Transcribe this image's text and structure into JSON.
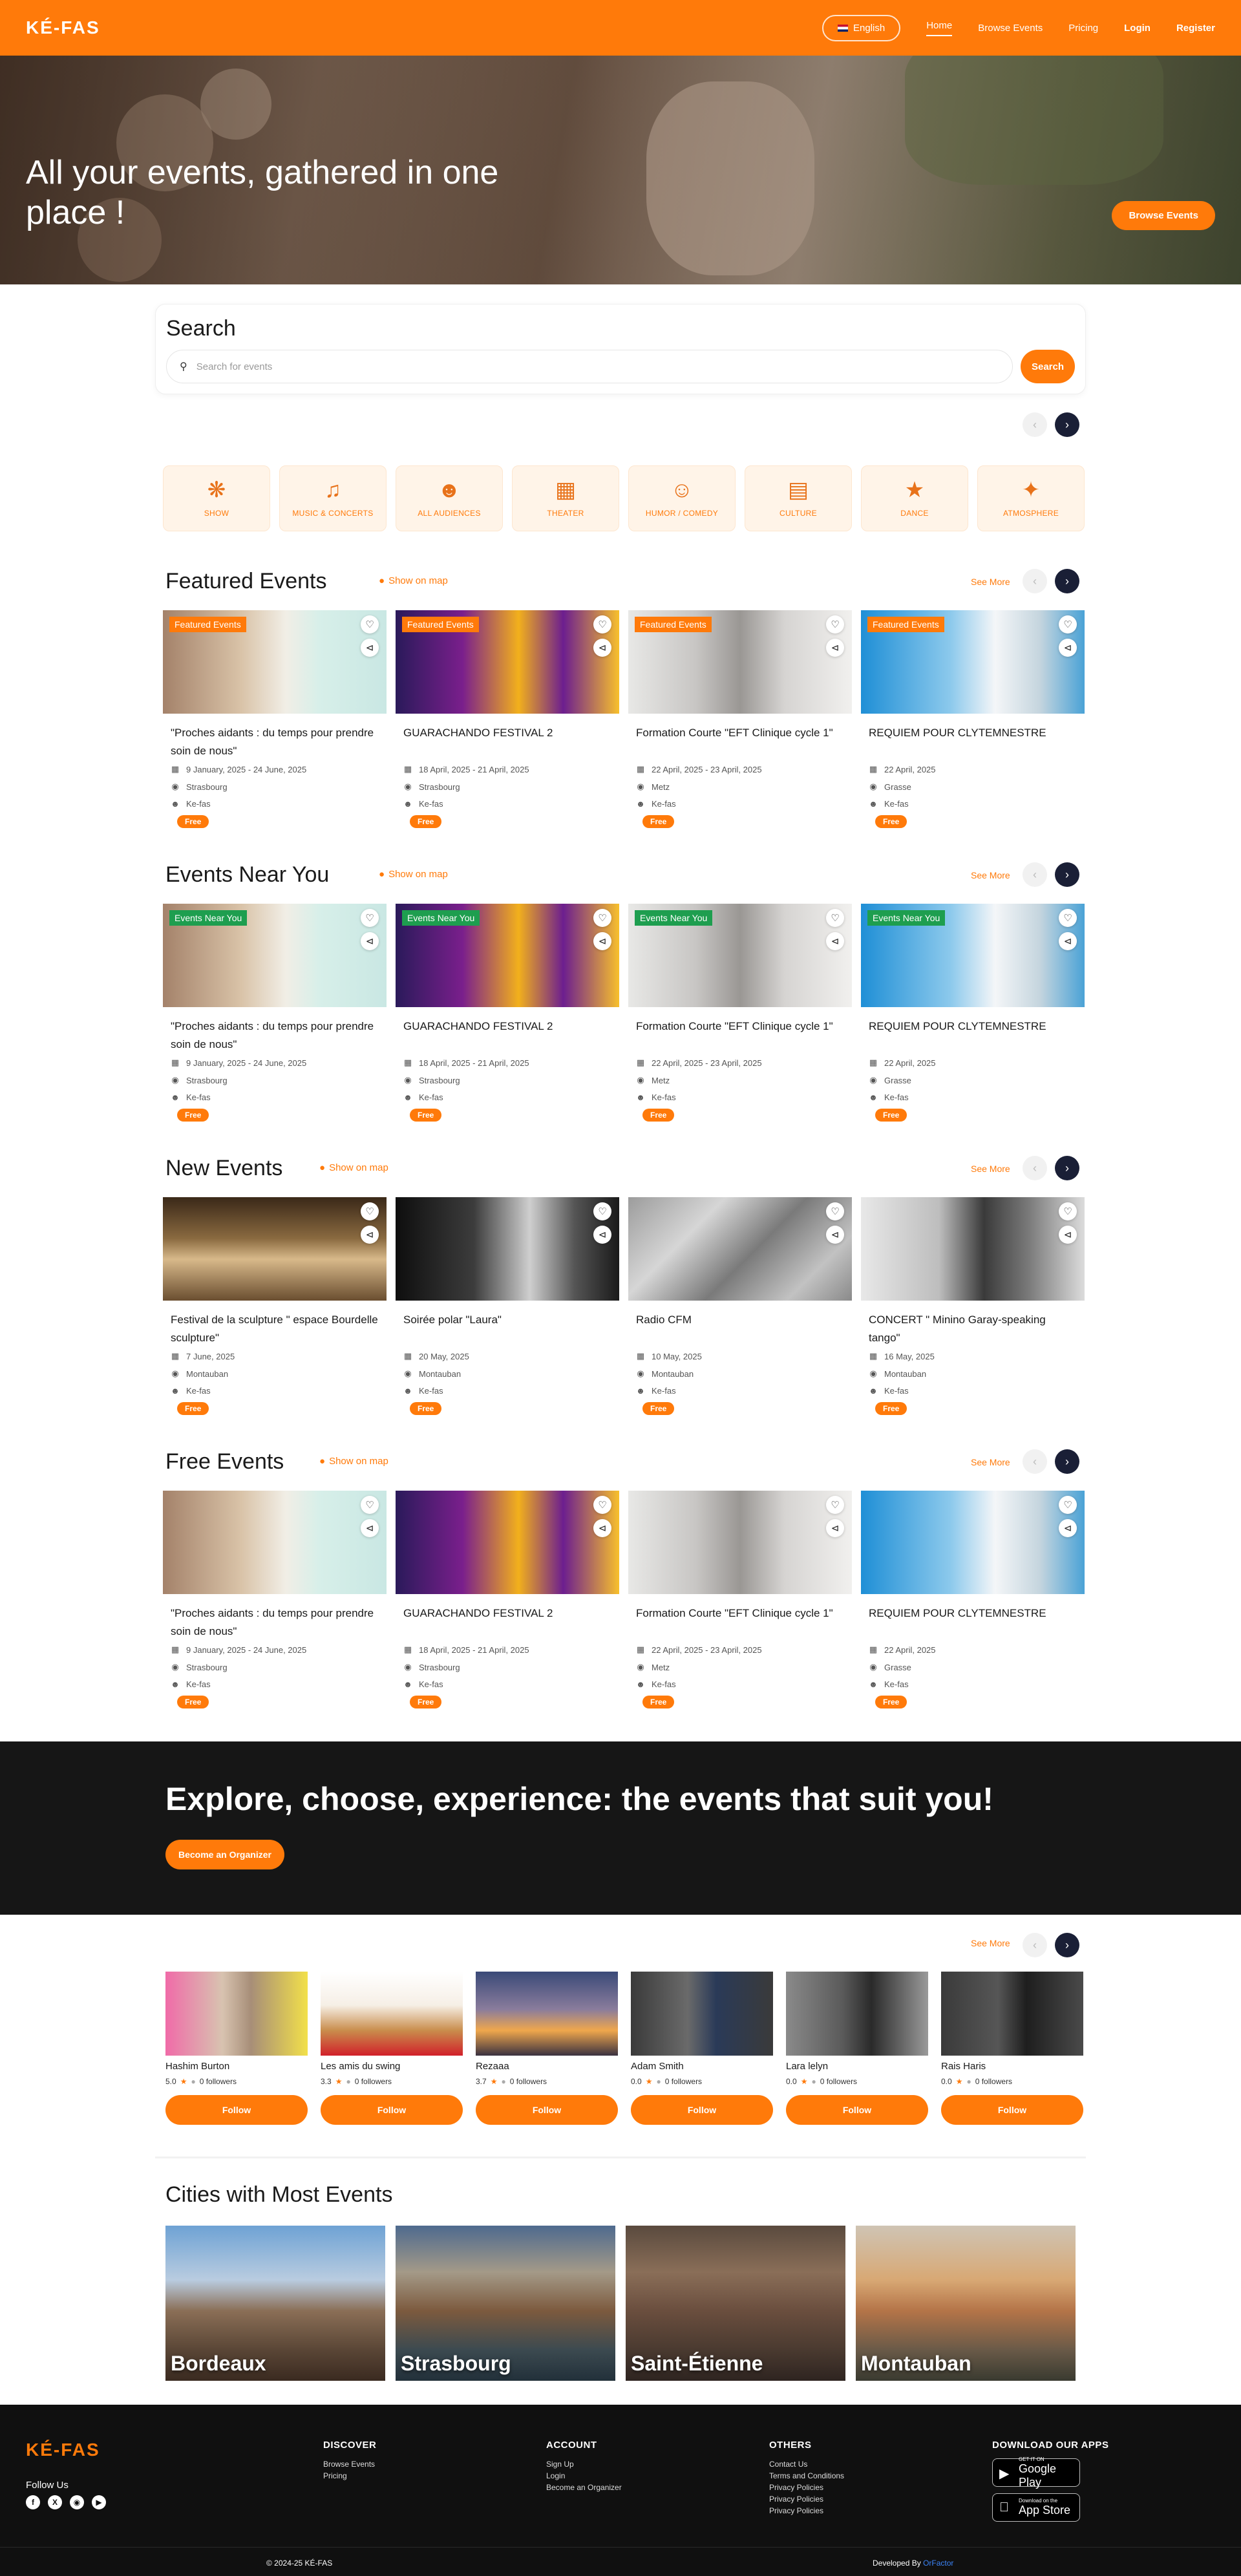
{
  "nav": {
    "logo": "KÉ-FAS",
    "language": "English",
    "links": [
      "Home",
      "Browse Events",
      "Pricing",
      "Login",
      "Register"
    ]
  },
  "hero": {
    "title": "All your events, gathered in one place !",
    "button": "Browse Events"
  },
  "search": {
    "title": "Search",
    "placeholder": "Search for events",
    "button": "Search"
  },
  "categories": [
    {
      "label": "SHOW",
      "icon": "juggler-icon"
    },
    {
      "label": "MUSIC & CONCERTS",
      "icon": "guitar-icon"
    },
    {
      "label": "ALL AUDIENCES",
      "icon": "family-icon"
    },
    {
      "label": "THEATER",
      "icon": "stage-icon"
    },
    {
      "label": "HUMOR / COMEDY",
      "icon": "laughing-face-icon"
    },
    {
      "label": "CULTURE",
      "icon": "books-icon"
    },
    {
      "label": "DANCE",
      "icon": "dancers-icon"
    },
    {
      "label": "ATMOSPHERE",
      "icon": "party-popper-icon"
    }
  ],
  "common": {
    "show_on_map": "Show on map",
    "see_more": "See More",
    "free": "Free"
  },
  "sections": [
    {
      "title": "Featured Events",
      "badge": "Featured Events",
      "events": [
        {
          "title": "\"Proches aidants : du temps pour prendre soin de nous\"",
          "date": "9 January, 2025 - 24 June, 2025",
          "city": "Strasbourg",
          "organizer": "Ke-fas",
          "price": "Free"
        },
        {
          "title": "GUARACHANDO FESTIVAL 2",
          "date": "18 April, 2025 - 21 April, 2025",
          "city": "Strasbourg",
          "organizer": "Ke-fas",
          "price": "Free"
        },
        {
          "title": "Formation Courte \"EFT Clinique cycle 1\"",
          "date": "22 April, 2025 - 23 April, 2025",
          "city": "Metz",
          "organizer": "Ke-fas",
          "price": "Free"
        },
        {
          "title": "REQUIEM POUR CLYTEMNESTRE",
          "date": "22 April, 2025",
          "city": "Grasse",
          "organizer": "Ke-fas",
          "price": "Free"
        }
      ]
    },
    {
      "title": "Events Near You",
      "badge": "Events Near You",
      "events": [
        {
          "title": "\"Proches aidants : du temps pour prendre soin de nous\"",
          "date": "9 January, 2025 - 24 June, 2025",
          "city": "Strasbourg",
          "organizer": "Ke-fas",
          "price": "Free"
        },
        {
          "title": "GUARACHANDO FESTIVAL 2",
          "date": "18 April, 2025 - 21 April, 2025",
          "city": "Strasbourg",
          "organizer": "Ke-fas",
          "price": "Free"
        },
        {
          "title": "Formation Courte \"EFT Clinique cycle 1\"",
          "date": "22 April, 2025 - 23 April, 2025",
          "city": "Metz",
          "organizer": "Ke-fas",
          "price": "Free"
        },
        {
          "title": "REQUIEM POUR CLYTEMNESTRE",
          "date": "22 April, 2025",
          "city": "Grasse",
          "organizer": "Ke-fas",
          "price": "Free"
        }
      ]
    },
    {
      "title": "New Events",
      "badge": "",
      "events": [
        {
          "title": "Festival de la sculpture \" espace Bourdelle sculpture\"",
          "date": "7 June, 2025",
          "city": "Montauban",
          "organizer": "Ke-fas",
          "price": "Free"
        },
        {
          "title": "Soirée polar \"Laura\"",
          "date": "20 May, 2025",
          "city": "Montauban",
          "organizer": "Ke-fas",
          "price": "Free"
        },
        {
          "title": "Radio CFM",
          "date": "10 May, 2025",
          "city": "Montauban",
          "organizer": "Ke-fas",
          "price": "Free"
        },
        {
          "title": "CONCERT \" Minino Garay-speaking tango\"",
          "date": "16 May, 2025",
          "city": "Montauban",
          "organizer": "Ke-fas",
          "price": "Free"
        }
      ]
    },
    {
      "title": "Free Events",
      "badge": "",
      "events": [
        {
          "title": "\"Proches aidants : du temps pour prendre soin de nous\"",
          "date": "9 January, 2025 - 24 June, 2025",
          "city": "Strasbourg",
          "organizer": "Ke-fas",
          "price": "Free"
        },
        {
          "title": "GUARACHANDO FESTIVAL 2",
          "date": "18 April, 2025 - 21 April, 2025",
          "city": "Strasbourg",
          "organizer": "Ke-fas",
          "price": "Free"
        },
        {
          "title": "Formation Courte \"EFT Clinique cycle 1\"",
          "date": "22 April, 2025 - 23 April, 2025",
          "city": "Metz",
          "organizer": "Ke-fas",
          "price": "Free"
        },
        {
          "title": "REQUIEM POUR CLYTEMNESTRE",
          "date": "22 April, 2025",
          "city": "Grasse",
          "organizer": "Ke-fas",
          "price": "Free"
        }
      ]
    }
  ],
  "banner": {
    "title": "Explore, choose, experience: the events that suit you!",
    "button": "Become an Organizer"
  },
  "organizers": {
    "see_more": "See More",
    "follow": "Follow",
    "items": [
      {
        "name": "Hashim Burton",
        "rating": "5.0",
        "followers": "0 followers"
      },
      {
        "name": "Les amis du swing",
        "rating": "3.3",
        "followers": "0 followers"
      },
      {
        "name": "Rezaaa",
        "rating": "3.7",
        "followers": "0 followers"
      },
      {
        "name": "Adam Smith",
        "rating": "0.0",
        "followers": "0 followers"
      },
      {
        "name": "Lara lelyn",
        "rating": "0.0",
        "followers": "0 followers"
      },
      {
        "name": "Rais Haris",
        "rating": "0.0",
        "followers": "0 followers"
      }
    ]
  },
  "cities": {
    "title": "Cities with Most Events",
    "items": [
      "Bordeaux",
      "Strasbourg",
      "Saint-Étienne",
      "Montauban"
    ]
  },
  "footer": {
    "logo": "KÉ-FAS",
    "follow_us": "Follow Us",
    "discover": {
      "title": "DISCOVER",
      "links": [
        "Browse Events",
        "Pricing"
      ]
    },
    "account": {
      "title": "ACCOUNT",
      "links": [
        "Sign Up",
        "Login",
        "Become an Organizer"
      ]
    },
    "others": {
      "title": "OTHERS",
      "links": [
        "Contact Us",
        "Terms and Conditions",
        "Privacy Policies",
        "Privacy Policies",
        "Privacy Policies"
      ]
    },
    "apps": {
      "title": "DOWNLOAD OUR APPS",
      "google_small": "GET IT ON",
      "google": "Google Play",
      "apple_small": "Download on the",
      "apple": "App Store"
    },
    "copyright": "© 2024-25 KÉ-FAS",
    "developed_prefix": "Developed By",
    "developer": "OrFactor"
  },
  "colors": {
    "accent": "#ff7a0a",
    "dark": "#161616",
    "green_badge": "#1e9e4f",
    "arrow_dark": "#1a1f36"
  }
}
